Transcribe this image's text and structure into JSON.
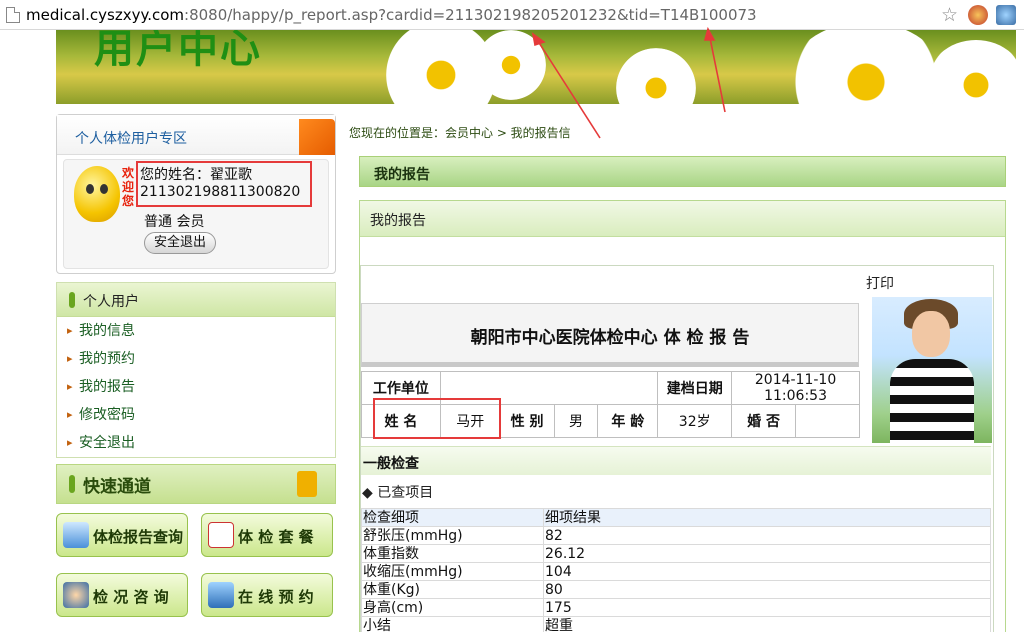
{
  "browser": {
    "url_host": "medical.cyszxyy.com",
    "url_rest": ":8080/happy/p_report.asp?cardid=211302198205201232&tid=T14B100073"
  },
  "banner": {
    "title": "用户中心"
  },
  "user_zone": {
    "title": "个人体检用户专区",
    "welcome": "欢迎您！",
    "name_label": "您的姓名：翟亚歌",
    "card_id": "211302198811300820",
    "level": "普通 会员",
    "logout": "安全退出"
  },
  "personal": {
    "title": "个人用户",
    "items": [
      "我的信息",
      "我的预约",
      "我的报告",
      "修改密码",
      "安全退出"
    ]
  },
  "quick": {
    "title": "快速通道",
    "buttons": [
      "体检报告查询",
      "体 检 套 餐",
      "检 况 咨 询",
      "在 线 预 约"
    ]
  },
  "breadcrumb": "您现在的位置是：会员中心 > 我的报告信",
  "report_header": "我的报告",
  "panel_title": "我的报告",
  "print": "打印",
  "report_title": "朝阳市中心医院体检中心 体 检 报 告",
  "info": {
    "work_unit_label": "工作单位",
    "work_unit_value": "",
    "file_date_label": "建档日期",
    "file_date_value": "2014-11-10 11:06:53",
    "name_label": "姓 名",
    "name_value": "马开",
    "gender_label": "性 别",
    "gender_value": "男",
    "age_label": "年 龄",
    "age_value": "32岁",
    "marriage_label": "婚 否",
    "marriage_value": ""
  },
  "general": {
    "title": "一般检查",
    "checked": "◆ 已查项目"
  },
  "results": {
    "headers": [
      "检查细项",
      "细项结果"
    ],
    "rows": [
      [
        "舒张压(mmHg)",
        "82"
      ],
      [
        "体重指数",
        "26.12"
      ],
      [
        "收缩压(mmHg)",
        "104"
      ],
      [
        "体重(Kg)",
        "80"
      ],
      [
        "身高(cm)",
        "175"
      ],
      [
        "小结",
        "超重"
      ]
    ]
  }
}
